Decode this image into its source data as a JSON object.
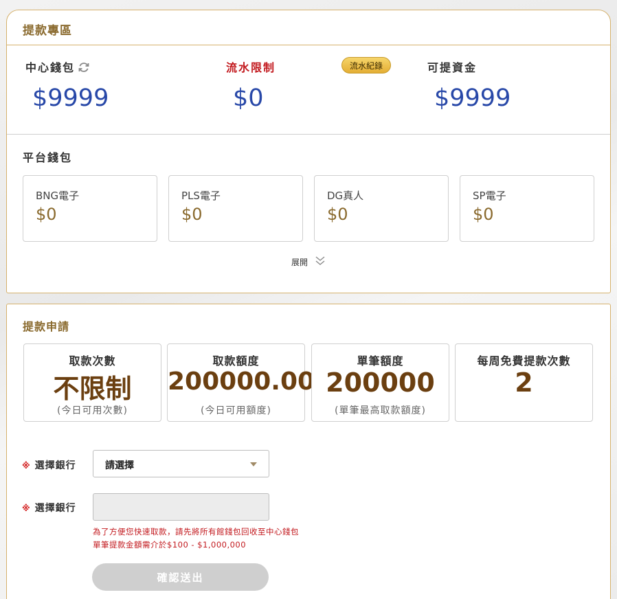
{
  "withdraw_zone": {
    "title": "提款專區",
    "center_wallet": {
      "label": "中心錢包",
      "value": "$9999"
    },
    "turnover_limit": {
      "label": "流水限制",
      "value": "$0",
      "record_badge": "流水紀錄"
    },
    "withdrawable": {
      "label": "可提資金",
      "value": "$9999"
    },
    "platform_wallet_label": "平台錢包",
    "wallets": [
      {
        "name": "BNG電子",
        "amount": "$0"
      },
      {
        "name": "PLS電子",
        "amount": "$0"
      },
      {
        "name": "DG真人",
        "amount": "$0"
      },
      {
        "name": "SP電子",
        "amount": "$0"
      }
    ],
    "expand_label": "展開"
  },
  "withdraw_apply": {
    "title": "提款申請",
    "limits": [
      {
        "title": "取款次數",
        "value": "不限制",
        "note": "(今日可用次數)"
      },
      {
        "title": "取款額度",
        "value": "200000.00",
        "note": "(今日可用額度)"
      },
      {
        "title": "單筆額度",
        "value": "200000",
        "note": "(單筆最高取款額度)"
      },
      {
        "title": "每周免費提款次數",
        "value": "2",
        "note": ""
      }
    ],
    "required_mark": "※",
    "bank_select": {
      "label": "選擇銀行",
      "value": "請選擇"
    },
    "bank_input": {
      "label": "選擇銀行",
      "value": ""
    },
    "hint_1": "為了方便您快速取款，請先將所有館錢包回收至中心錢包",
    "hint_2": "單筆提款金額需介於$100 - $1,000,000",
    "submit_label": "確認送出"
  },
  "colors": {
    "accent_gold": "#d5b06a",
    "title_brown": "#8a6a2e",
    "value_blue": "#2848a8",
    "limit_red": "#c2181d",
    "button_disabled": "#cfcfcf"
  }
}
